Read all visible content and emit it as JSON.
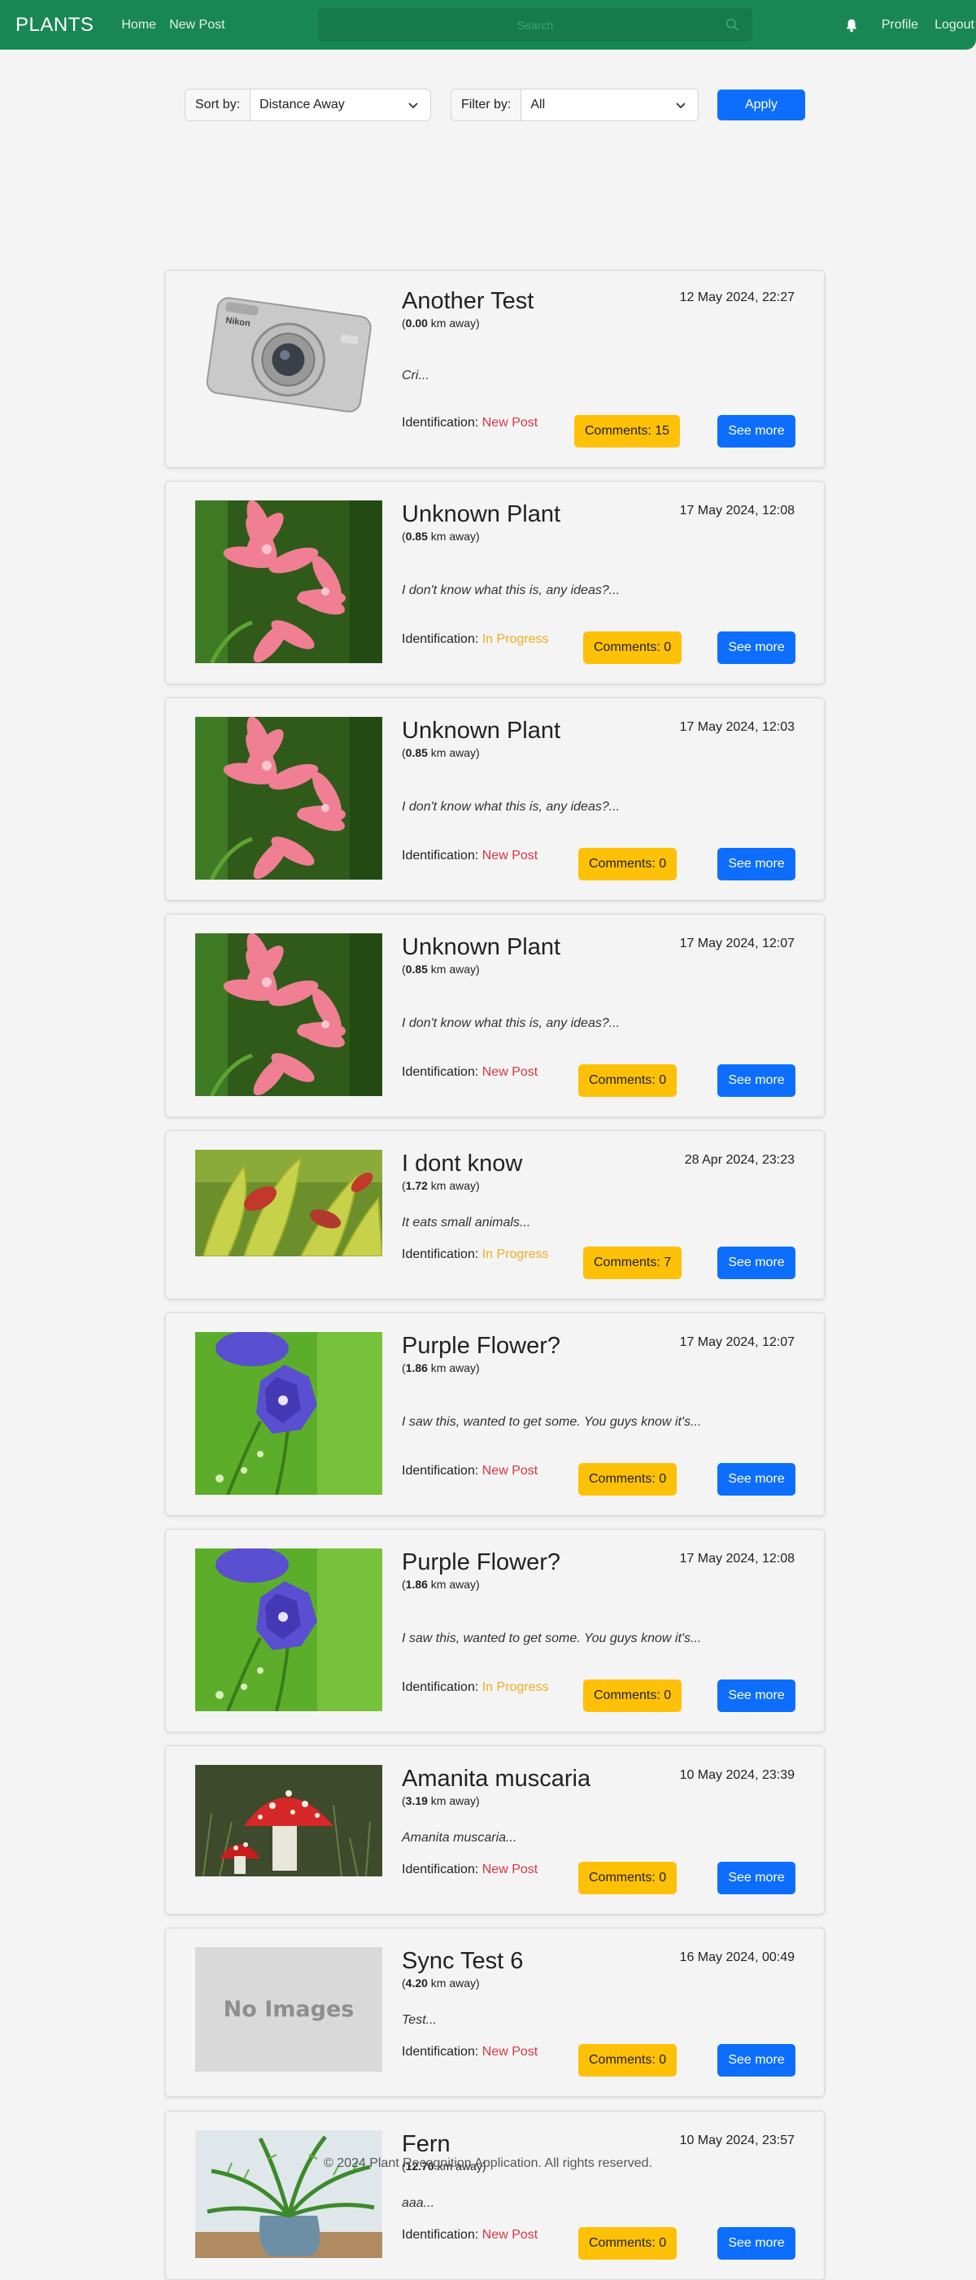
{
  "nav": {
    "brand": "PLANTS",
    "home": "Home",
    "new_post": "New Post",
    "search_placeholder": "Search",
    "profile": "Profile",
    "logout": "Logout"
  },
  "filters": {
    "sort_label": "Sort by:",
    "sort_value": "Distance Away",
    "filter_label": "Filter by:",
    "filter_value": "All",
    "apply": "Apply"
  },
  "posts": [
    {
      "title": "Another Test",
      "distance": "0.00",
      "distance_suffix": " km away)",
      "date": "12 May 2024, 22:27",
      "description": "Cri...",
      "ident_label": "Identification: ",
      "status": "New Post",
      "comments": "Comments: 15",
      "see_more": "See more",
      "image": "camera"
    },
    {
      "title": "Unknown Plant",
      "distance": "0.85",
      "distance_suffix": " km away)",
      "date": "17 May 2024, 12:08",
      "description": "I don't know what this is, any ideas?...",
      "ident_label": "Identification: ",
      "status": "In Progress",
      "comments": "Comments: 0",
      "see_more": "See more",
      "image": "pink-lily"
    },
    {
      "title": "Unknown Plant",
      "distance": "0.85",
      "distance_suffix": " km away)",
      "date": "17 May 2024, 12:03",
      "description": "I don't know what this is, any ideas?...",
      "ident_label": "Identification: ",
      "status": "New Post",
      "comments": "Comments: 0",
      "see_more": "See more",
      "image": "pink-lily"
    },
    {
      "title": "Unknown Plant",
      "distance": "0.85",
      "distance_suffix": " km away)",
      "date": "17 May 2024, 12:07",
      "description": "I don't know what this is, any ideas?...",
      "ident_label": "Identification: ",
      "status": "New Post",
      "comments": "Comments: 0",
      "see_more": "See more",
      "image": "pink-lily"
    },
    {
      "title": "I dont know",
      "distance": "1.72",
      "distance_suffix": " km away)",
      "date": "28 Apr 2024, 23:23",
      "description": "It eats small animals...",
      "ident_label": "Identification: ",
      "status": "In Progress",
      "comments": "Comments: 7",
      "see_more": "See more",
      "image": "venus-flytrap"
    },
    {
      "title": "Purple Flower?",
      "distance": "1.86",
      "distance_suffix": " km away)",
      "date": "17 May 2024, 12:07",
      "description": "I saw this, wanted to get some. You guys know it's...",
      "ident_label": "Identification: ",
      "status": "New Post",
      "comments": "Comments: 0",
      "see_more": "See more",
      "image": "purple-flower"
    },
    {
      "title": "Purple Flower?",
      "distance": "1.86",
      "distance_suffix": " km away)",
      "date": "17 May 2024, 12:08",
      "description": "I saw this, wanted to get some. You guys know it's...",
      "ident_label": "Identification: ",
      "status": "In Progress",
      "comments": "Comments: 0",
      "see_more": "See more",
      "image": "purple-flower"
    },
    {
      "title": "Amanita muscaria",
      "distance": "3.19",
      "distance_suffix": " km away)",
      "date": "10 May 2024, 23:39",
      "description": "Amanita muscaria...",
      "ident_label": "Identification: ",
      "status": "New Post",
      "comments": "Comments: 0",
      "see_more": "See more",
      "image": "mushroom"
    },
    {
      "title": "Sync Test 6",
      "distance": "4.20",
      "distance_suffix": " km away)",
      "date": "16 May 2024, 00:49",
      "description": "Test...",
      "ident_label": "Identification: ",
      "status": "New Post",
      "comments": "Comments: 0",
      "see_more": "See more",
      "image": "no-images",
      "image_text": "No Images"
    },
    {
      "title": "Fern",
      "distance": "12.70",
      "distance_suffix": " km away)",
      "date": "10 May 2024, 23:57",
      "description": "aaa...",
      "ident_label": "Identification: ",
      "status": "New Post",
      "comments": "Comments: 0",
      "see_more": "See more",
      "image": "fern"
    }
  ],
  "colors": {
    "navbar": "#198754",
    "primary": "#0d6efd",
    "warning": "#ffc107",
    "status_new": "#dc3545",
    "status_in_progress": "#f0ad1e"
  },
  "footer": "© 2024 Plant Recognition Application. All rights reserved."
}
